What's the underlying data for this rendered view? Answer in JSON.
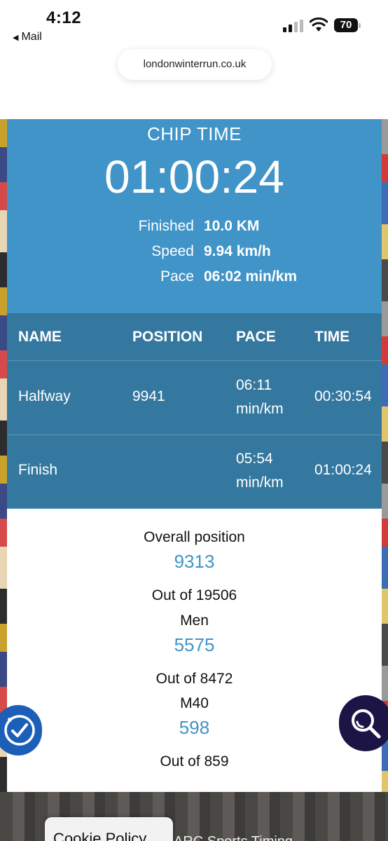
{
  "status_bar": {
    "time": "4:12",
    "back_label": "Mail",
    "battery": "70"
  },
  "browser": {
    "url": "londonwinterrun.co.uk"
  },
  "result": {
    "chip_time_label": "CHIP TIME",
    "chip_time": "01:00:24",
    "stats": [
      {
        "label": "Finished",
        "value": "10.0 KM"
      },
      {
        "label": "Speed",
        "value": "9.94 km/h"
      },
      {
        "label": "Pace",
        "value": "06:02 min/km"
      }
    ],
    "accent_color": "#4194c8",
    "table_color": "#34789f"
  },
  "splits": {
    "headers": [
      "NAME",
      "POSITION",
      "PACE",
      "TIME"
    ],
    "rows": [
      {
        "name": "Halfway",
        "position": "9941",
        "pace_value": "06:11",
        "pace_unit": "min/km",
        "time": "00:30:54"
      },
      {
        "name": "Finish",
        "position": "",
        "pace_value": "05:54",
        "pace_unit": "min/km",
        "time": "01:00:24"
      }
    ]
  },
  "positions": {
    "overall_label": "Overall position",
    "overall_value": "9313",
    "overall_total": "Out of 19506",
    "gender_label": "Men",
    "gender_value": "5575",
    "gender_total": "Out of 8472",
    "category_label": "M40",
    "category_value": "598",
    "category_total": "Out of 859"
  },
  "footer": {
    "cookie_label": "Cookie Policy",
    "partial_text": "ARC Sports Timing"
  },
  "icons": {
    "accessibility": "accessibility-icon",
    "search": "search-icon",
    "signal": "cellular-signal-icon",
    "wifi": "wifi-icon",
    "battery": "battery-icon"
  }
}
